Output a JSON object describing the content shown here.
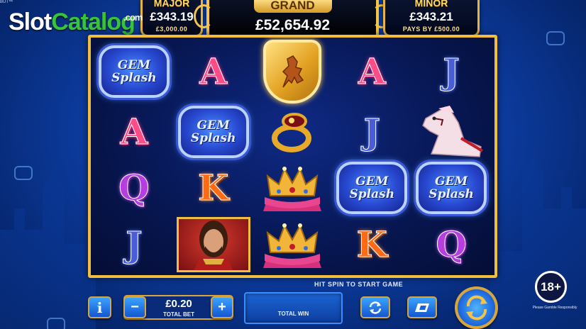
{
  "watermark": {
    "part1": "Slot",
    "part2": "Catalog",
    "suffix": ".com"
  },
  "corner_text": "BUT™",
  "jackpots": {
    "major": {
      "title": "MAJOR",
      "value": "£343.19",
      "sub": "£3,000.00"
    },
    "grand": {
      "title": "GRAND",
      "value": "£52,654.92"
    },
    "minor": {
      "title": "MINOR",
      "value": "£343.21",
      "sub": "PAYS BY £500.00"
    }
  },
  "reels": [
    [
      {
        "type": "gem",
        "line1": "GEM",
        "line2": "Splash"
      },
      {
        "type": "letter",
        "text": "A",
        "cls": "sym-A"
      },
      {
        "type": "shield",
        "name": "lion-shield"
      },
      {
        "type": "letter",
        "text": "A",
        "cls": "sym-A"
      },
      {
        "type": "letter",
        "text": "J",
        "cls": "sym-J"
      }
    ],
    [
      {
        "type": "letter",
        "text": "A",
        "cls": "sym-A"
      },
      {
        "type": "gem",
        "line1": "GEM",
        "line2": "Splash"
      },
      {
        "type": "ring",
        "name": "gold-ring"
      },
      {
        "type": "letter",
        "text": "J",
        "cls": "sym-J"
      },
      {
        "type": "horse",
        "name": "white-horse"
      }
    ],
    [
      {
        "type": "letter",
        "text": "Q",
        "cls": "sym-Q"
      },
      {
        "type": "letter",
        "text": "K",
        "cls": "sym-K"
      },
      {
        "type": "crown",
        "name": "crown"
      },
      {
        "type": "gem",
        "line1": "GEM",
        "line2": "Splash"
      },
      {
        "type": "gem",
        "line1": "GEM",
        "line2": "Splash"
      }
    ],
    [
      {
        "type": "letter",
        "text": "J",
        "cls": "sym-J"
      },
      {
        "type": "hero",
        "name": "knight-portrait"
      },
      {
        "type": "crown",
        "name": "crown"
      },
      {
        "type": "letter",
        "text": "K",
        "cls": "sym-K"
      },
      {
        "type": "letter",
        "text": "Q",
        "cls": "sym-Q"
      }
    ]
  ],
  "hint": "HIT SPIN TO START GAME",
  "bet": {
    "value": "£0.20",
    "label": "TOTAL BET"
  },
  "win": {
    "label": "TOTAL WIN",
    "value": ""
  },
  "buttons": {
    "info": "i",
    "minus": "−",
    "plus": "+",
    "info_icon": "info-icon",
    "autoplay_icon": "autoplay-icon",
    "turbo_icon": "turbo-icon",
    "spin_icon": "spin-icon"
  },
  "age": {
    "label": "18+",
    "note": "Please Gamble Responsibly"
  },
  "colors": {
    "frame_gold": "#f0bd3f",
    "accent_blue": "#1c64d8",
    "watermark_green": "#36c53a"
  }
}
